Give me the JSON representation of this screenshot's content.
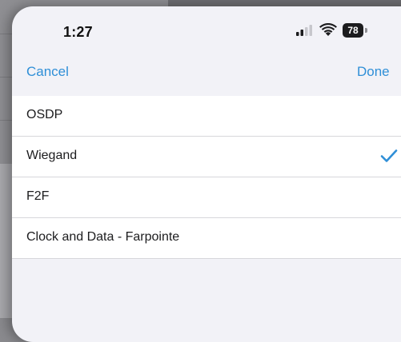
{
  "status_bar": {
    "time": "1:27",
    "battery_level": "78",
    "icons": [
      "cellular-signal-icon",
      "wifi-icon",
      "battery-icon"
    ]
  },
  "nav": {
    "cancel_label": "Cancel",
    "done_label": "Done"
  },
  "options": [
    {
      "label": "OSDP",
      "selected": false
    },
    {
      "label": "Wiegand",
      "selected": true
    },
    {
      "label": "F2F",
      "selected": false
    },
    {
      "label": "Clock and Data - Farpointe",
      "selected": false
    }
  ],
  "colors": {
    "accent": "#2f8fd7",
    "sheet_background": "#f2f2f7",
    "row_background": "#ffffff",
    "text": "#1c1c1e"
  }
}
